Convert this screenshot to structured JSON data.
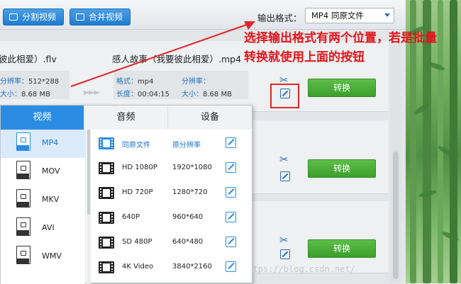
{
  "toolbar": {
    "split_label": "分割视频",
    "merge_label": "合并视频",
    "output_format_label": "输出格式：",
    "output_format_value": "MP4  同原文件"
  },
  "files": [
    {
      "name": "彼此相爱）.flv",
      "resolution_key": "分辨率：",
      "resolution": "512*288",
      "size_key": "大小：",
      "size": "8.68 MB",
      "out_name": "感人故事（我要彼此相爱）.mp4",
      "format_key": "格式：",
      "format": "mp4",
      "length_key": "长度：",
      "length": "00:04:15",
      "out_resolution_key": "分辨率：",
      "out_resolution": "",
      "out_size_key": "大小：",
      "out_size": "8.68 MB",
      "convert_label": "转换"
    },
    {
      "convert_label": "转换"
    },
    {
      "convert_label": "转换"
    }
  ],
  "annotation": {
    "text": "选择输出格式有两个位置，若是批量转换就使用上面的按钮",
    "color": "#e0161b"
  },
  "watermark": "https://blog.csdn.net/",
  "popup": {
    "tabs": [
      "视频",
      "音频",
      "设备"
    ],
    "formats": [
      "MP4",
      "MOV",
      "MKV",
      "AVI",
      "WMV"
    ],
    "presets": [
      {
        "name": "同原文件",
        "resolution": "原分辨率"
      },
      {
        "name": "HD 1080P",
        "resolution": "1920*1080"
      },
      {
        "name": "HD 720P",
        "resolution": "1280*720"
      },
      {
        "name": "640P",
        "resolution": "960*640"
      },
      {
        "name": "SD 480P",
        "resolution": "640*480"
      },
      {
        "name": "4K Video",
        "resolution": "3840*2160"
      }
    ]
  },
  "colors": {
    "accent": "#2b8ce4",
    "convert": "#4cae3b",
    "annotation": "#e0161b"
  }
}
